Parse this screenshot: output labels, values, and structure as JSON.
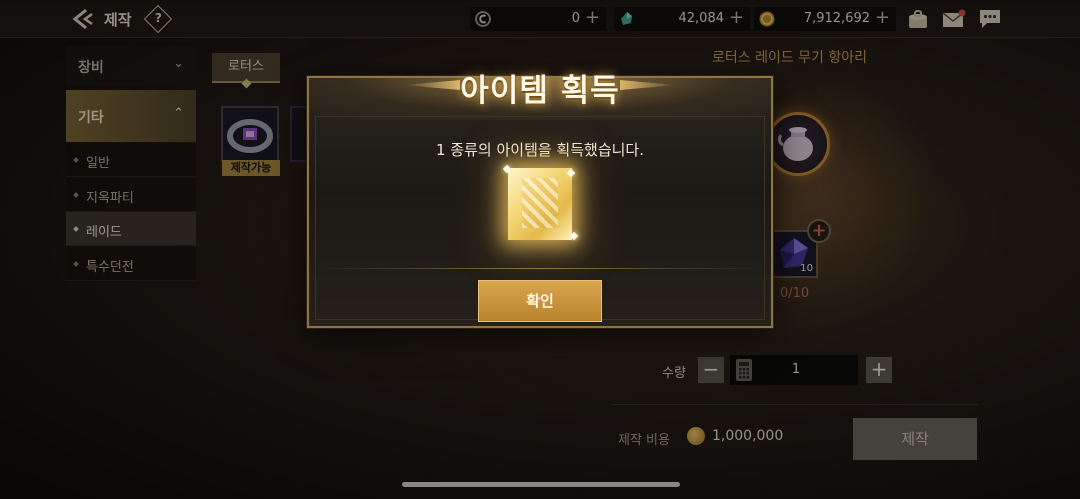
{
  "header": {
    "title": "제작",
    "help_label": "?",
    "currencies": [
      {
        "icon": "c-token-icon",
        "value": "0"
      },
      {
        "icon": "crystal-icon",
        "value": "42,084"
      },
      {
        "icon": "gold-coin-icon",
        "value": "7,912,692"
      }
    ],
    "plus_label": "+"
  },
  "sidebar": {
    "groups": [
      {
        "label": "장비",
        "expanded": false
      },
      {
        "label": "기타",
        "expanded": true
      }
    ],
    "sub_items": [
      "일반",
      "지옥파티",
      "레이드",
      "특수던전"
    ],
    "selected": "레이드"
  },
  "tabs": {
    "active": "로터스"
  },
  "item_badge": "제작가능",
  "recipe": {
    "title": "로터스 레이드 무기 항아리",
    "material_count": "10",
    "material_progress": "0/10",
    "add_symbol": "+"
  },
  "quantity": {
    "label": "수량",
    "value": "1",
    "minus": "−",
    "plus": "+"
  },
  "cost": {
    "label": "제작 비용",
    "value": "1,000,000"
  },
  "craft_button": "제작",
  "modal": {
    "title": "아이템 획득",
    "message": "1 종류의 아이템을 획득했습니다.",
    "confirm_label": "확인"
  },
  "colors": {
    "accent_gold": "#c59b55",
    "confirm_button": "#c8923a",
    "recipe_title": "#c59b55"
  }
}
